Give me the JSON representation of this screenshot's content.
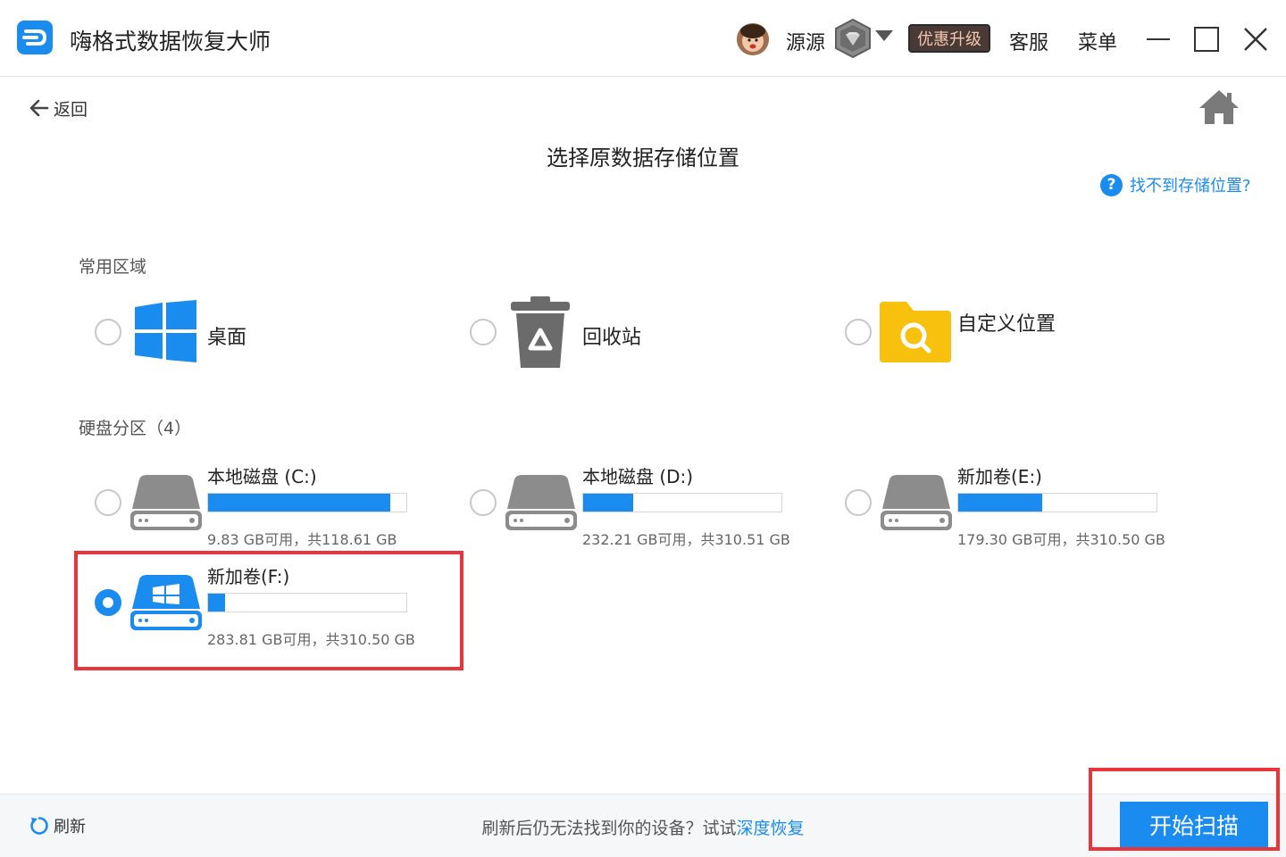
{
  "app": {
    "title": "嗨格式数据恢复大师",
    "user_name": "源源",
    "upgrade_label": "优惠升级",
    "support_label": "客服",
    "menu_label": "菜单"
  },
  "nav": {
    "back_label": "返回"
  },
  "page": {
    "title": "选择原数据存储位置",
    "help_label": "找不到存储位置?"
  },
  "common": {
    "section_label": "常用区域",
    "items": [
      {
        "label": "桌面",
        "icon": "windows-icon",
        "selected": false
      },
      {
        "label": "回收站",
        "icon": "recycle-bin-icon",
        "selected": false
      },
      {
        "label": "自定义位置",
        "icon": "folder-search-icon",
        "selected": false
      }
    ]
  },
  "drives": {
    "section_label": "硬盘分区（4）",
    "items": [
      {
        "name": "本地磁盘 (C:)",
        "info": "9.83 GB可用，共118.61 GB",
        "used_fraction": 0.917,
        "selected": false
      },
      {
        "name": "本地磁盘 (D:)",
        "info": "232.21 GB可用，共310.51 GB",
        "used_fraction": 0.252,
        "selected": false
      },
      {
        "name": "新加卷(E:)",
        "info": "179.30 GB可用，共310.50 GB",
        "used_fraction": 0.423,
        "selected": false
      },
      {
        "name": "新加卷(F:)",
        "info": "283.81 GB可用，共310.50 GB",
        "used_fraction": 0.086,
        "selected": true
      }
    ]
  },
  "footer": {
    "refresh_label": "刷新",
    "hint_text": "刷新后仍无法找到你的设备？试试",
    "deep_recovery_label": "深度恢复",
    "scan_label": "开始扫描"
  },
  "colors": {
    "accent": "#1a8cf0",
    "highlight": "#e8343a",
    "folder": "#f7c10d",
    "drive_gray": "#8c8c8c"
  }
}
